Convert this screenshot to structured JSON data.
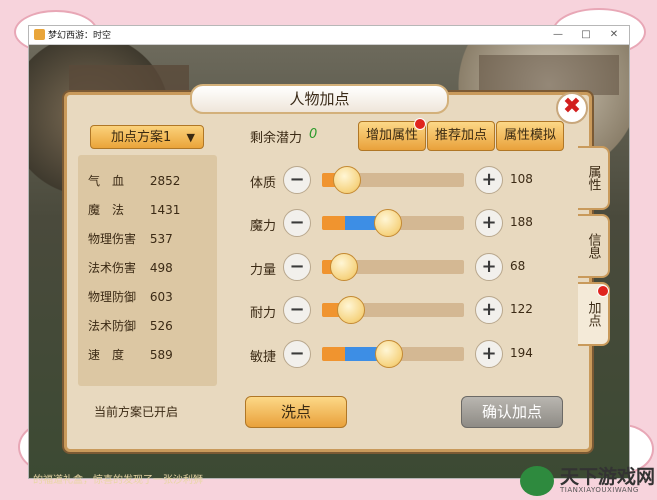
{
  "window": {
    "title": "梦幻西游：时空",
    "controls": [
      "—",
      "□",
      "✕"
    ]
  },
  "panel": {
    "title": "人物加点",
    "plan_select": "加点方案1",
    "stats": [
      {
        "label": "气　血",
        "value": "2852"
      },
      {
        "label": "魔　法",
        "value": "1431"
      },
      {
        "label": "物理伤害",
        "value": "537"
      },
      {
        "label": "法术伤害",
        "value": "498"
      },
      {
        "label": "物理防御",
        "value": "603"
      },
      {
        "label": "法术防御",
        "value": "526"
      },
      {
        "label": "速　度",
        "value": "589"
      }
    ],
    "current_plan_text": "当前方案已开启",
    "potential_label": "剩余潜力",
    "potential_value": "0",
    "top_buttons": [
      "增加属性",
      "推荐加点",
      "属性模拟"
    ],
    "attributes": [
      {
        "label": "体质",
        "value": "108",
        "fill_orange": 0.16,
        "fill_blue": 0.0
      },
      {
        "label": "魔力",
        "value": "188",
        "fill_orange": 0.16,
        "fill_blue": 0.29
      },
      {
        "label": "力量",
        "value": "68",
        "fill_orange": 0.14,
        "fill_blue": 0.0
      },
      {
        "label": "耐力",
        "value": "122",
        "fill_orange": 0.19,
        "fill_blue": 0.0
      },
      {
        "label": "敏捷",
        "value": "194",
        "fill_orange": 0.16,
        "fill_blue": 0.3
      }
    ],
    "minus_symbol": "−",
    "plus_symbol": "+",
    "wash_button": "洗点",
    "confirm_button": "确认加点",
    "side_tabs": [
      "属性",
      "信息",
      "加点"
    ],
    "close_symbol": "✖"
  },
  "scene": {
    "chat_text": "的福道礼盒，惊喜的发现了一张沙利狮"
  },
  "watermark": {
    "name": "天下游戏网",
    "url": "TIANXIAYOUXIWANG"
  },
  "colors": {
    "accent_orange": "#f0942f",
    "accent_blue": "#3d8ee5",
    "panel_bg": "#e8d9bf",
    "potential_green": "#2c9b2c",
    "close_red": "#d21f1f"
  }
}
